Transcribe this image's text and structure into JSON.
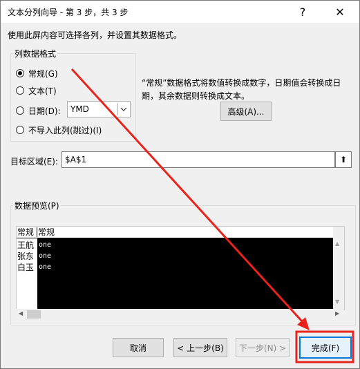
{
  "dialog": {
    "title": "文本分列向导 - 第 3 步，共 3 步",
    "help_glyph": "?",
    "close_glyph": "✕",
    "instructions": "使用此屏内容可选择各列，并设置其数据格式。"
  },
  "column_format": {
    "legend": "列数据格式",
    "options": [
      {
        "label": "常规(G)",
        "selected": true
      },
      {
        "label": "文本(T)",
        "selected": false
      },
      {
        "label": "日期(D):",
        "selected": false
      },
      {
        "label": "不导入此列(跳过)(I)",
        "selected": false
      }
    ],
    "date_format_value": "YMD",
    "description": [
      "“常规”数据格式将数值转换成数字，日期值会转换成日",
      "期，其余数据则转换成文本。"
    ],
    "advanced_label": "高级(A)..."
  },
  "destination": {
    "label": "目标区域(E):",
    "value": "$A$1",
    "collapse_glyph": "⬆"
  },
  "preview": {
    "legend": "数据预览(P)",
    "headers": [
      "常规",
      "常规"
    ],
    "rows": [
      [
        "王航",
        "one"
      ],
      [
        "张东",
        "one"
      ],
      [
        "白玉",
        "one"
      ]
    ],
    "scroll_up_glyph": "▲",
    "scroll_down_glyph": "▼",
    "scroll_left_glyph": "◀",
    "scroll_right_glyph": "▶"
  },
  "buttons": {
    "cancel": "取消",
    "back": "< 上一步(B)",
    "next": "下一步(N) >",
    "finish": "完成(F)"
  },
  "colors": {
    "annotation_red": "#e8231c",
    "preview_bg": "#000000"
  }
}
